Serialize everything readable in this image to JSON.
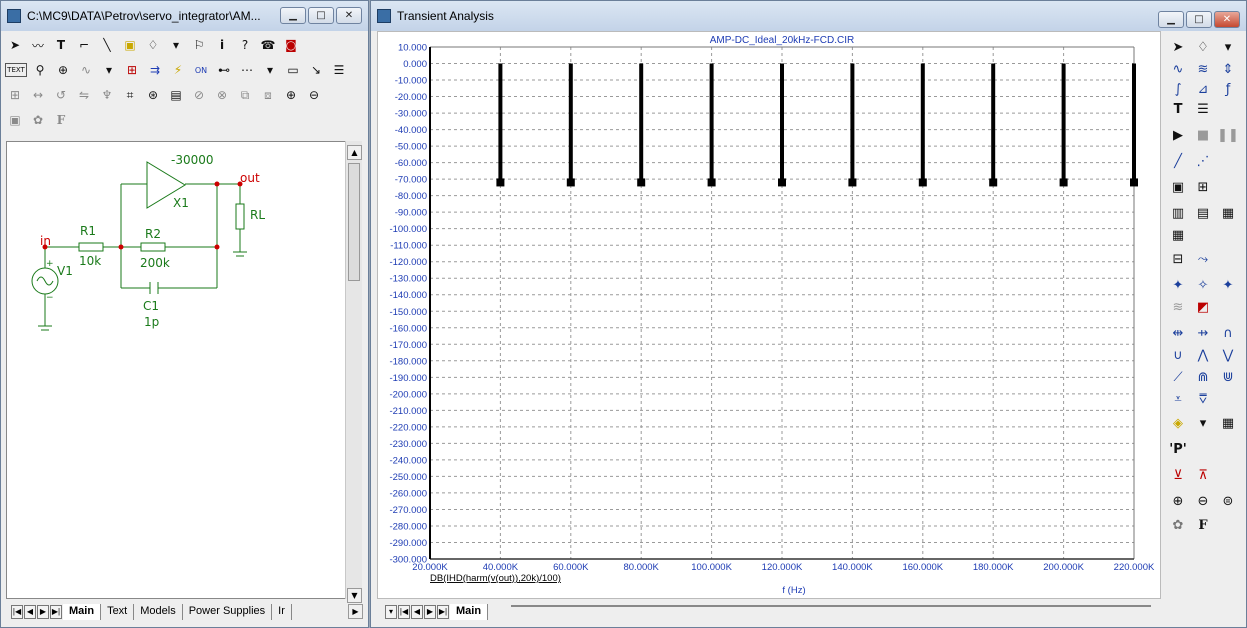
{
  "schematic_window": {
    "title": "C:\\MC9\\DATA\\Petrov\\servo_integrator\\AM...",
    "tabs": [
      "Main",
      "Text",
      "Models",
      "Power Supplies",
      "Ir"
    ]
  },
  "schematic": {
    "components": {
      "amp_gain": "-30000",
      "amp_name": "X1",
      "r1_name": "R1",
      "r1_value": "10k",
      "r2_name": "R2",
      "r2_value": "200k",
      "c1_name": "C1",
      "c1_value": "1p",
      "source_name": "V1",
      "load_name": "RL"
    },
    "nodes": {
      "in": "in",
      "out": "out"
    }
  },
  "analysis_window": {
    "title": "Transient Analysis",
    "tabs": [
      "Main"
    ]
  },
  "colors": {
    "accent": "#1e3cb4",
    "wire": "#1a7a1a",
    "node": "#cc0000",
    "component_text": "#1a7a1a"
  },
  "chart_data": {
    "type": "bar",
    "title": "AMP-DC_Ideal_20kHz-FCD.CIR",
    "xlabel": "f (Hz)",
    "ylabel": "",
    "series_label": "DB(IHD(harm(v(out)),20k)/100)",
    "xlim": [
      20000,
      220000
    ],
    "ylim": [
      -300,
      10
    ],
    "x_ticks": [
      "20.000K",
      "40.000K",
      "60.000K",
      "80.000K",
      "100.000K",
      "120.000K",
      "140.000K",
      "160.000K",
      "180.000K",
      "200.000K",
      "220.000K"
    ],
    "y_ticks": [
      "10.000",
      "0.000",
      "-10.000",
      "-20.000",
      "-30.000",
      "-40.000",
      "-50.000",
      "-60.000",
      "-70.000",
      "-80.000",
      "-90.000",
      "-100.000",
      "-110.000",
      "-120.000",
      "-130.000",
      "-140.000",
      "-150.000",
      "-160.000",
      "-170.000",
      "-180.000",
      "-190.000",
      "-200.000",
      "-210.000",
      "-220.000",
      "-230.000",
      "-240.000",
      "-250.000",
      "-260.000",
      "-270.000",
      "-280.000",
      "-290.000",
      "-300.000"
    ],
    "x": [
      40000,
      60000,
      80000,
      100000,
      120000,
      140000,
      160000,
      180000,
      200000,
      220000
    ],
    "values": [
      -72,
      -72,
      -72,
      -72,
      -72,
      -72,
      -72,
      -72,
      -72,
      -72
    ],
    "grid": true
  }
}
